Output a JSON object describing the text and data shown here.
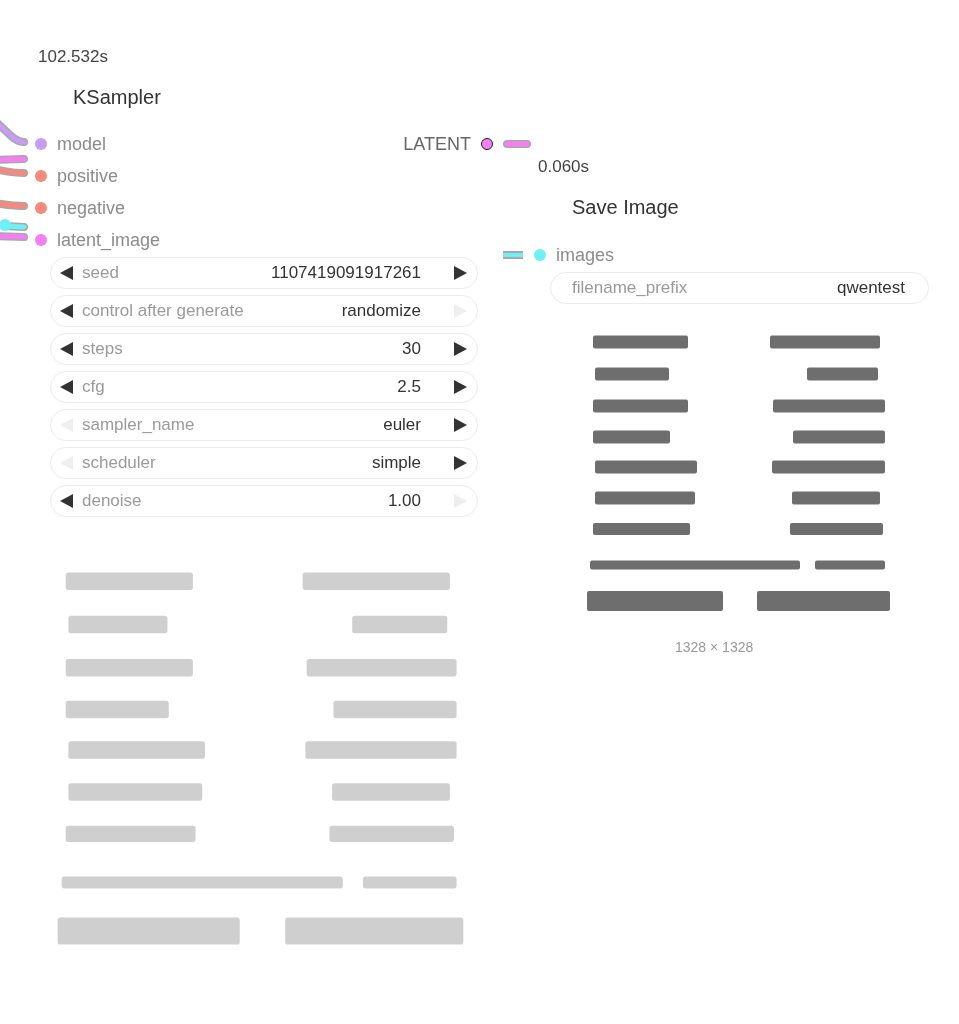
{
  "ksampler": {
    "timing": "102.532s",
    "title": "KSampler",
    "inputs": [
      {
        "label": "model",
        "color": "#c89cf5"
      },
      {
        "label": "positive",
        "color": "#f7877f"
      },
      {
        "label": "negative",
        "color": "#f7877f"
      },
      {
        "label": "latent_image",
        "color": "#f57ef5"
      }
    ],
    "output": {
      "label": "LATENT",
      "color": "#f57ef5"
    },
    "widgets": [
      {
        "label": "seed",
        "value": "1107419091917261",
        "prev_disabled": false,
        "next_disabled": false
      },
      {
        "label": "control after generate",
        "value": "randomize",
        "prev_disabled": false,
        "next_disabled": true
      },
      {
        "label": "steps",
        "value": "30",
        "prev_disabled": false,
        "next_disabled": false
      },
      {
        "label": "cfg",
        "value": "2.5",
        "prev_disabled": false,
        "next_disabled": false
      },
      {
        "label": "sampler_name",
        "value": "euler",
        "prev_disabled": true,
        "next_disabled": false
      },
      {
        "label": "scheduler",
        "value": "simple",
        "prev_disabled": true,
        "next_disabled": false
      },
      {
        "label": "denoise",
        "value": "1.00",
        "prev_disabled": false,
        "next_disabled": true
      }
    ]
  },
  "save_image": {
    "timing": "0.060s",
    "title": "Save Image",
    "inputs": [
      {
        "label": "images",
        "color": "#6ef0f7"
      }
    ],
    "widgets": [
      {
        "label": "filename_prefix",
        "value": "qwentest"
      }
    ],
    "image_size": "1328 × 1328"
  }
}
